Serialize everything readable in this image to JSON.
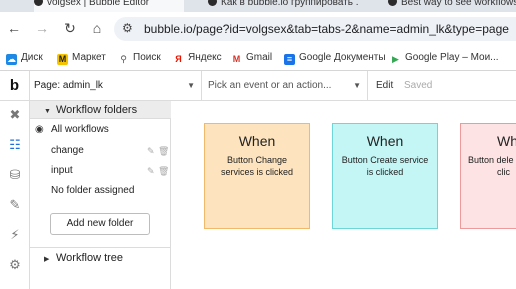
{
  "browser": {
    "tabs": [
      {
        "label": "volgsex | Bubble Editor"
      },
      {
        "label": "Как в bubble.io группировать ..."
      },
      {
        "label": "Best way to see workflows..."
      }
    ],
    "url": "bubble.io/page?id=volgsex&tab=tabs-2&name=admin_lk&type=page",
    "bookmarks": [
      {
        "label": "Диск",
        "icon": "drive-icon",
        "color": "#1e88e5"
      },
      {
        "label": "Маркет",
        "icon": "market-icon",
        "color": "#f5c400"
      },
      {
        "label": "Поиск",
        "icon": "search-icon",
        "color": "#555555"
      },
      {
        "label": "Яндекс",
        "icon": "yandex-icon",
        "color": "#e61400"
      },
      {
        "label": "Gmail",
        "icon": "gmail-icon",
        "color": "#d93025"
      },
      {
        "label": "Google Документы",
        "icon": "docs-icon",
        "color": "#1a73e8"
      },
      {
        "label": "Google Play – Мои...",
        "icon": "play-icon",
        "color": "#34a853"
      }
    ]
  },
  "editor": {
    "logo": "b",
    "page_select": "Page: admin_lk",
    "event_select": "Pick an event or an action...",
    "edit_label": "Edit",
    "saved_label": "Saved"
  },
  "panel": {
    "folders_header": "Workflow folders",
    "items": [
      {
        "label": "All workflows"
      },
      {
        "label": "change"
      },
      {
        "label": "input"
      },
      {
        "label": "No folder assigned"
      }
    ],
    "add_folder_button": "Add new folder",
    "tree_header": "Workflow tree"
  },
  "workflows": [
    {
      "when": "When",
      "line1": "Button Change",
      "line2": "services is clicked",
      "color": "#fde4bf"
    },
    {
      "when": "When",
      "line1": "Button Create service",
      "line2": "is clicked",
      "color": "#c5f6f6"
    },
    {
      "when": "Wh",
      "line1": "Button dele",
      "line2": "clic",
      "color": "#fde3e3"
    }
  ]
}
